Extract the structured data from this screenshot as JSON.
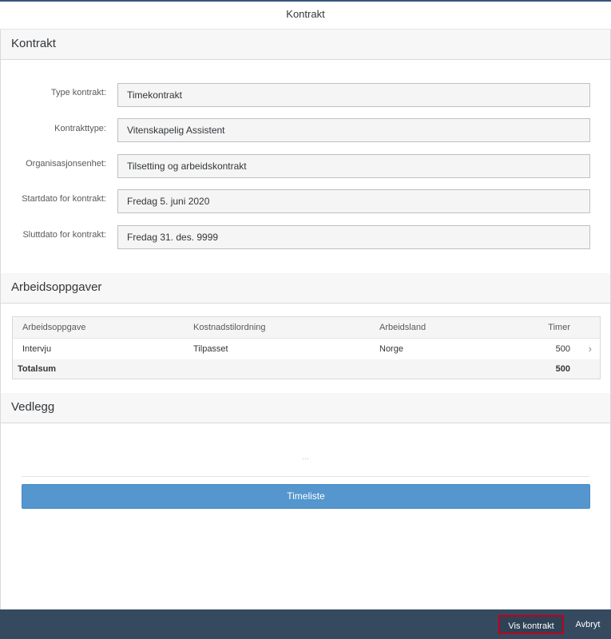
{
  "dialog": {
    "title": "Kontrakt"
  },
  "contract_section": {
    "title": "Kontrakt",
    "fields": [
      {
        "label": "Type kontrakt:",
        "value": "Timekontrakt"
      },
      {
        "label": "Kontrakttype:",
        "value": "Vitenskapelig Assistent"
      },
      {
        "label": "Organisasjonsenhet:",
        "value": "Tilsetting og arbeidskontrakt"
      },
      {
        "label": "Startdato for kontrakt:",
        "value": "Fredag 5. juni 2020"
      },
      {
        "label": "Sluttdato for kontrakt:",
        "value": "Fredag 31. des. 9999"
      }
    ]
  },
  "tasks_section": {
    "title": "Arbeidsoppgaver",
    "columns": [
      "Arbeidsoppgave",
      "Kostnadstilordning",
      "Arbeidsland",
      "Timer"
    ],
    "rows": [
      {
        "task": "Intervju",
        "cost": "Tilpasset",
        "country": "Norge",
        "hours": "500"
      }
    ],
    "total": {
      "label": "Totalsum",
      "value": "500"
    }
  },
  "attachments_section": {
    "title": "Vedlegg",
    "empty_text": "...",
    "timeliste_label": "Timeliste"
  },
  "footer": {
    "vis_kontrakt_label": "Vis kontrakt",
    "avbryt_label": "Avbryt"
  },
  "colors": {
    "primary_button": "#5496cd",
    "footer_bg": "#354a5f",
    "highlight_border": "#c2001b"
  }
}
